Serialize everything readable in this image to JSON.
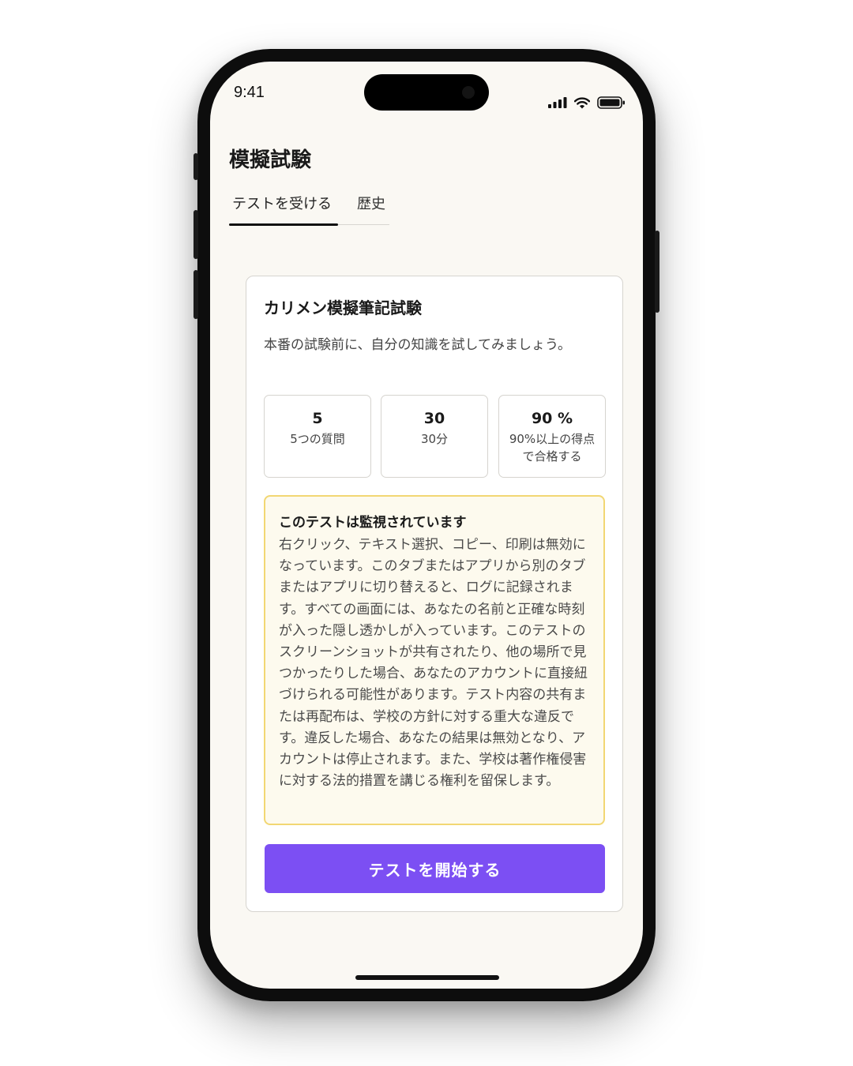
{
  "status_bar": {
    "time": "9:41"
  },
  "page": {
    "title": "模擬試験"
  },
  "tabs": [
    {
      "label": "テストを受ける",
      "active": true
    },
    {
      "label": "歴史",
      "active": false
    }
  ],
  "card": {
    "title": "カリメン模擬筆記試験",
    "description": "本番の試験前に、自分の知識を試してみましょう。",
    "stats": [
      {
        "value": "5",
        "label": "5つの質問"
      },
      {
        "value": "30",
        "label": "30分"
      },
      {
        "value": "90 %",
        "label": "90%以上の得点で合格する"
      }
    ],
    "notice": {
      "title": "このテストは監視されています",
      "body": "右クリック、テキスト選択、コピー、印刷は無効になっています。このタブまたはアプリから別のタブまたはアプリに切り替えると、ログに記録されます。すべての画面には、あなたの名前と正確な時刻が入った隠し透かしが入っています。このテストのスクリーンショットが共有されたり、他の場所で見つかったりした場合、あなたのアカウントに直接紐づけられる可能性があります。テスト内容の共有または再配布は、学校の方針に対する重大な違反です。違反した場合、あなたの結果は無効となり、アカウントは停止されます。また、学校は著作権侵害に対する法的措置を講じる権利を留保します。"
    },
    "start_button": "テストを開始する"
  },
  "colors": {
    "accent": "#7c4ff3",
    "notice_bg": "#fdfaee",
    "notice_border": "#f2d773",
    "screen_bg": "#faf8f3"
  },
  "icons": [
    "signal-icon",
    "wifi-icon",
    "battery-icon"
  ]
}
